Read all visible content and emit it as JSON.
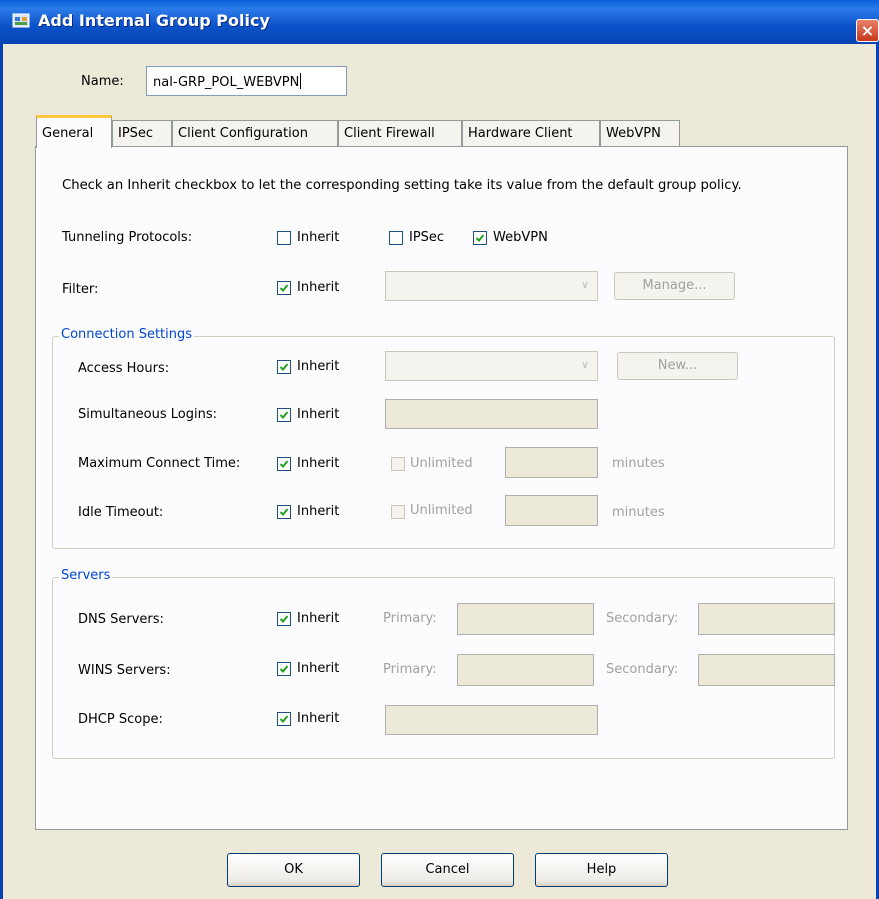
{
  "window": {
    "title": "Add Internal Group Policy",
    "close_glyph": "×"
  },
  "name": {
    "label": "Name:",
    "value": "nal-GRP_POL_WEBVPN"
  },
  "tabs": [
    {
      "label": "General",
      "active": true
    },
    {
      "label": "IPSec"
    },
    {
      "label": "Client Configuration"
    },
    {
      "label": "Client Firewall"
    },
    {
      "label": "Hardware Client"
    },
    {
      "label": "WebVPN"
    }
  ],
  "general": {
    "instruction": "Check an Inherit checkbox to let the corresponding setting take its value from the default group policy.",
    "inherit_label": "Inherit",
    "tunneling": {
      "label": "Tunneling Protocols:",
      "inherit": false,
      "ipsec_label": "IPSec",
      "ipsec": false,
      "webvpn_label": "WebVPN",
      "webvpn": true
    },
    "filter": {
      "label": "Filter:",
      "inherit": true,
      "manage_label": "Manage..."
    },
    "connection": {
      "title": "Connection Settings",
      "access_hours": {
        "label": "Access Hours:",
        "inherit": true,
        "new_label": "New..."
      },
      "simultaneous": {
        "label": "Simultaneous Logins:",
        "inherit": true
      },
      "max_connect": {
        "label": "Maximum Connect Time:",
        "inherit": true,
        "unlimited_label": "Unlimited",
        "unit": "minutes"
      },
      "idle": {
        "label": "Idle Timeout:",
        "inherit": true,
        "unlimited_label": "Unlimited",
        "unit": "minutes"
      }
    },
    "servers": {
      "title": "Servers",
      "dns": {
        "label": "DNS Servers:",
        "inherit": true,
        "primary_label": "Primary:",
        "secondary_label": "Secondary:"
      },
      "wins": {
        "label": "WINS Servers:",
        "inherit": true,
        "primary_label": "Primary:",
        "secondary_label": "Secondary:"
      },
      "dhcp": {
        "label": "DHCP Scope:",
        "inherit": true
      }
    }
  },
  "buttons": {
    "ok": "OK",
    "cancel": "Cancel",
    "help": "Help"
  },
  "colors": {
    "titlebar": "#0A5FD8",
    "group_title": "#0046D5",
    "tab_highlight": "#FFC83C"
  }
}
